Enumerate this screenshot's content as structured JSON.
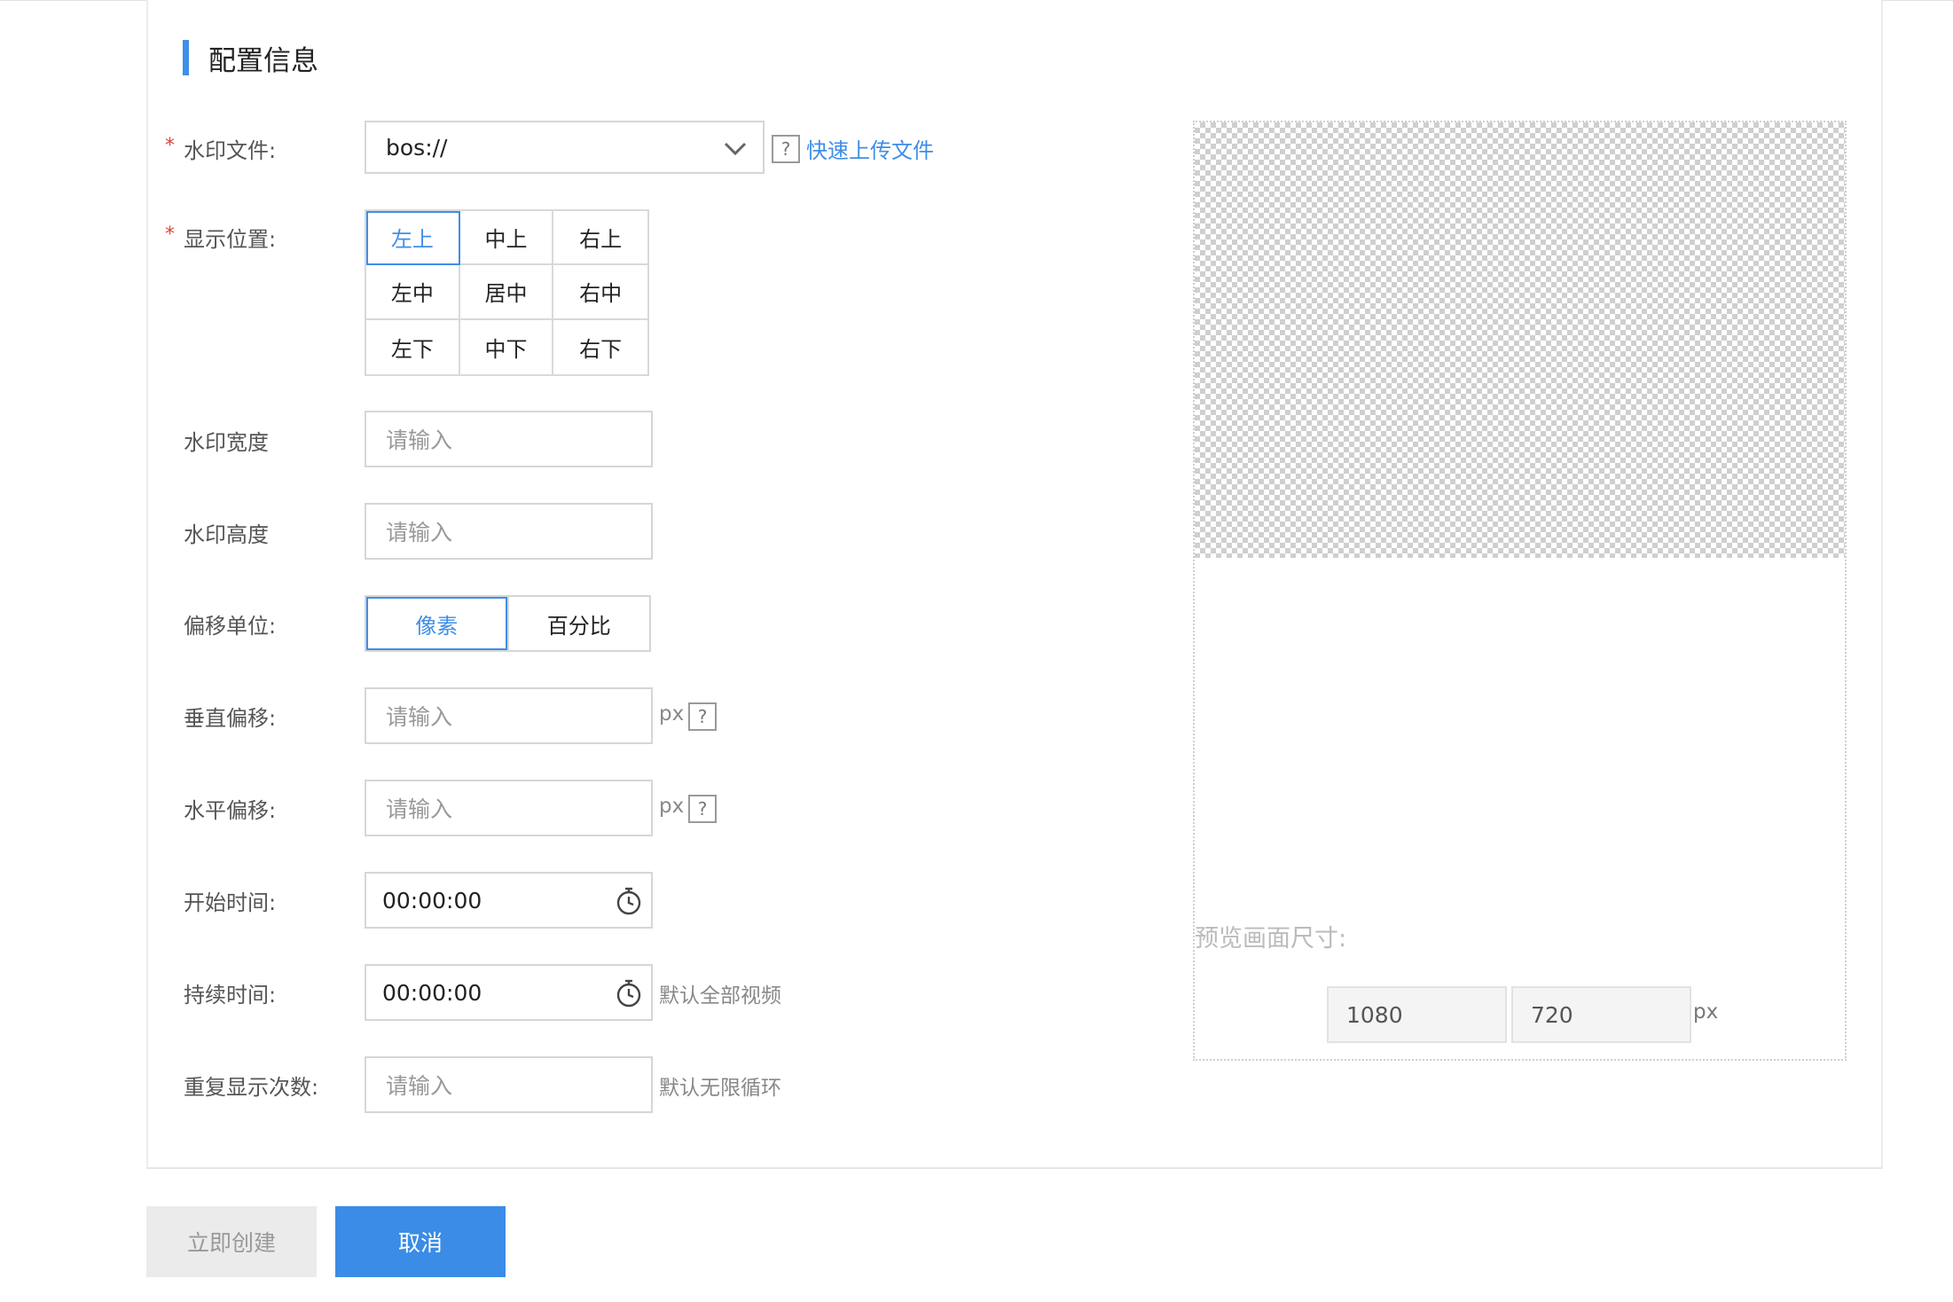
{
  "section": {
    "title": "配置信息"
  },
  "watermark_file": {
    "label": "水印文件:",
    "required_mark": "*",
    "select_value": "bos://",
    "help_glyph": "?",
    "upload_link": "快速上传文件"
  },
  "position": {
    "label": "显示位置:",
    "required_mark": "*",
    "options": [
      "左上",
      "中上",
      "右上",
      "左中",
      "居中",
      "右中",
      "左下",
      "中下",
      "右下"
    ],
    "selected": "左上"
  },
  "width": {
    "label": "水印宽度",
    "placeholder": "请输入"
  },
  "height": {
    "label": "水印高度",
    "placeholder": "请输入"
  },
  "offset_unit": {
    "label": "偏移单位:",
    "options": [
      "像素",
      "百分比"
    ],
    "selected": "像素"
  },
  "vertical_offset": {
    "label": "垂直偏移:",
    "placeholder": "请输入",
    "unit": "px",
    "help_glyph": "?"
  },
  "horizontal_offset": {
    "label": "水平偏移:",
    "placeholder": "请输入",
    "unit": "px",
    "help_glyph": "?"
  },
  "start_time": {
    "label": "开始时间:",
    "value": "00:00:00"
  },
  "duration": {
    "label": "持续时间:",
    "value": "00:00:00",
    "hint": "默认全部视频"
  },
  "repeat": {
    "label": "重复显示次数:",
    "placeholder": "请输入",
    "hint": "默认无限循环"
  },
  "preview": {
    "label": "预览画面尺寸:",
    "width": "1080",
    "height": "720",
    "unit": "px"
  },
  "actions": {
    "create": "立即创建",
    "cancel": "取消"
  },
  "colors": {
    "accent": "#3f8ee8",
    "required": "#e0453a",
    "primary_button": "#3a8ce6"
  }
}
